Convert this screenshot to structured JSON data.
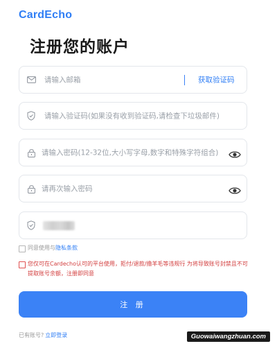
{
  "brand": {
    "logo": "CardEcho"
  },
  "page": {
    "title": "注册您的账户"
  },
  "form": {
    "email_placeholder": "请输入邮箱",
    "get_code_label": "获取验证码",
    "code_placeholder": "请输入验证码(如果没有收到验证码,请检查下垃圾邮件)",
    "password_placeholder": "请输入密码(12-32位,大小写字母,数字和特殊字符组合)",
    "confirm_placeholder": "请再次输入密码",
    "captcha_value": "obscured"
  },
  "agreement": {
    "prefix": "同意使用与",
    "link": "隐私条款"
  },
  "warning": {
    "text": "您仅可在Cardecho认可的平台使用，拒付/退款/撸羊毛等违规行 为将导致账号封禁且不可提取账号余额，注册即同意"
  },
  "submit": {
    "label": "注 册"
  },
  "footer": {
    "have_account": "已有账号?",
    "login_link": "立即登录",
    "watermark": "Guowaiwangzhuan.com"
  },
  "colors": {
    "accent": "#3b82f6",
    "warning": "#d23c3c"
  },
  "icons": [
    "mail-icon",
    "shield-icon",
    "lock-icon",
    "eye-icon"
  ]
}
